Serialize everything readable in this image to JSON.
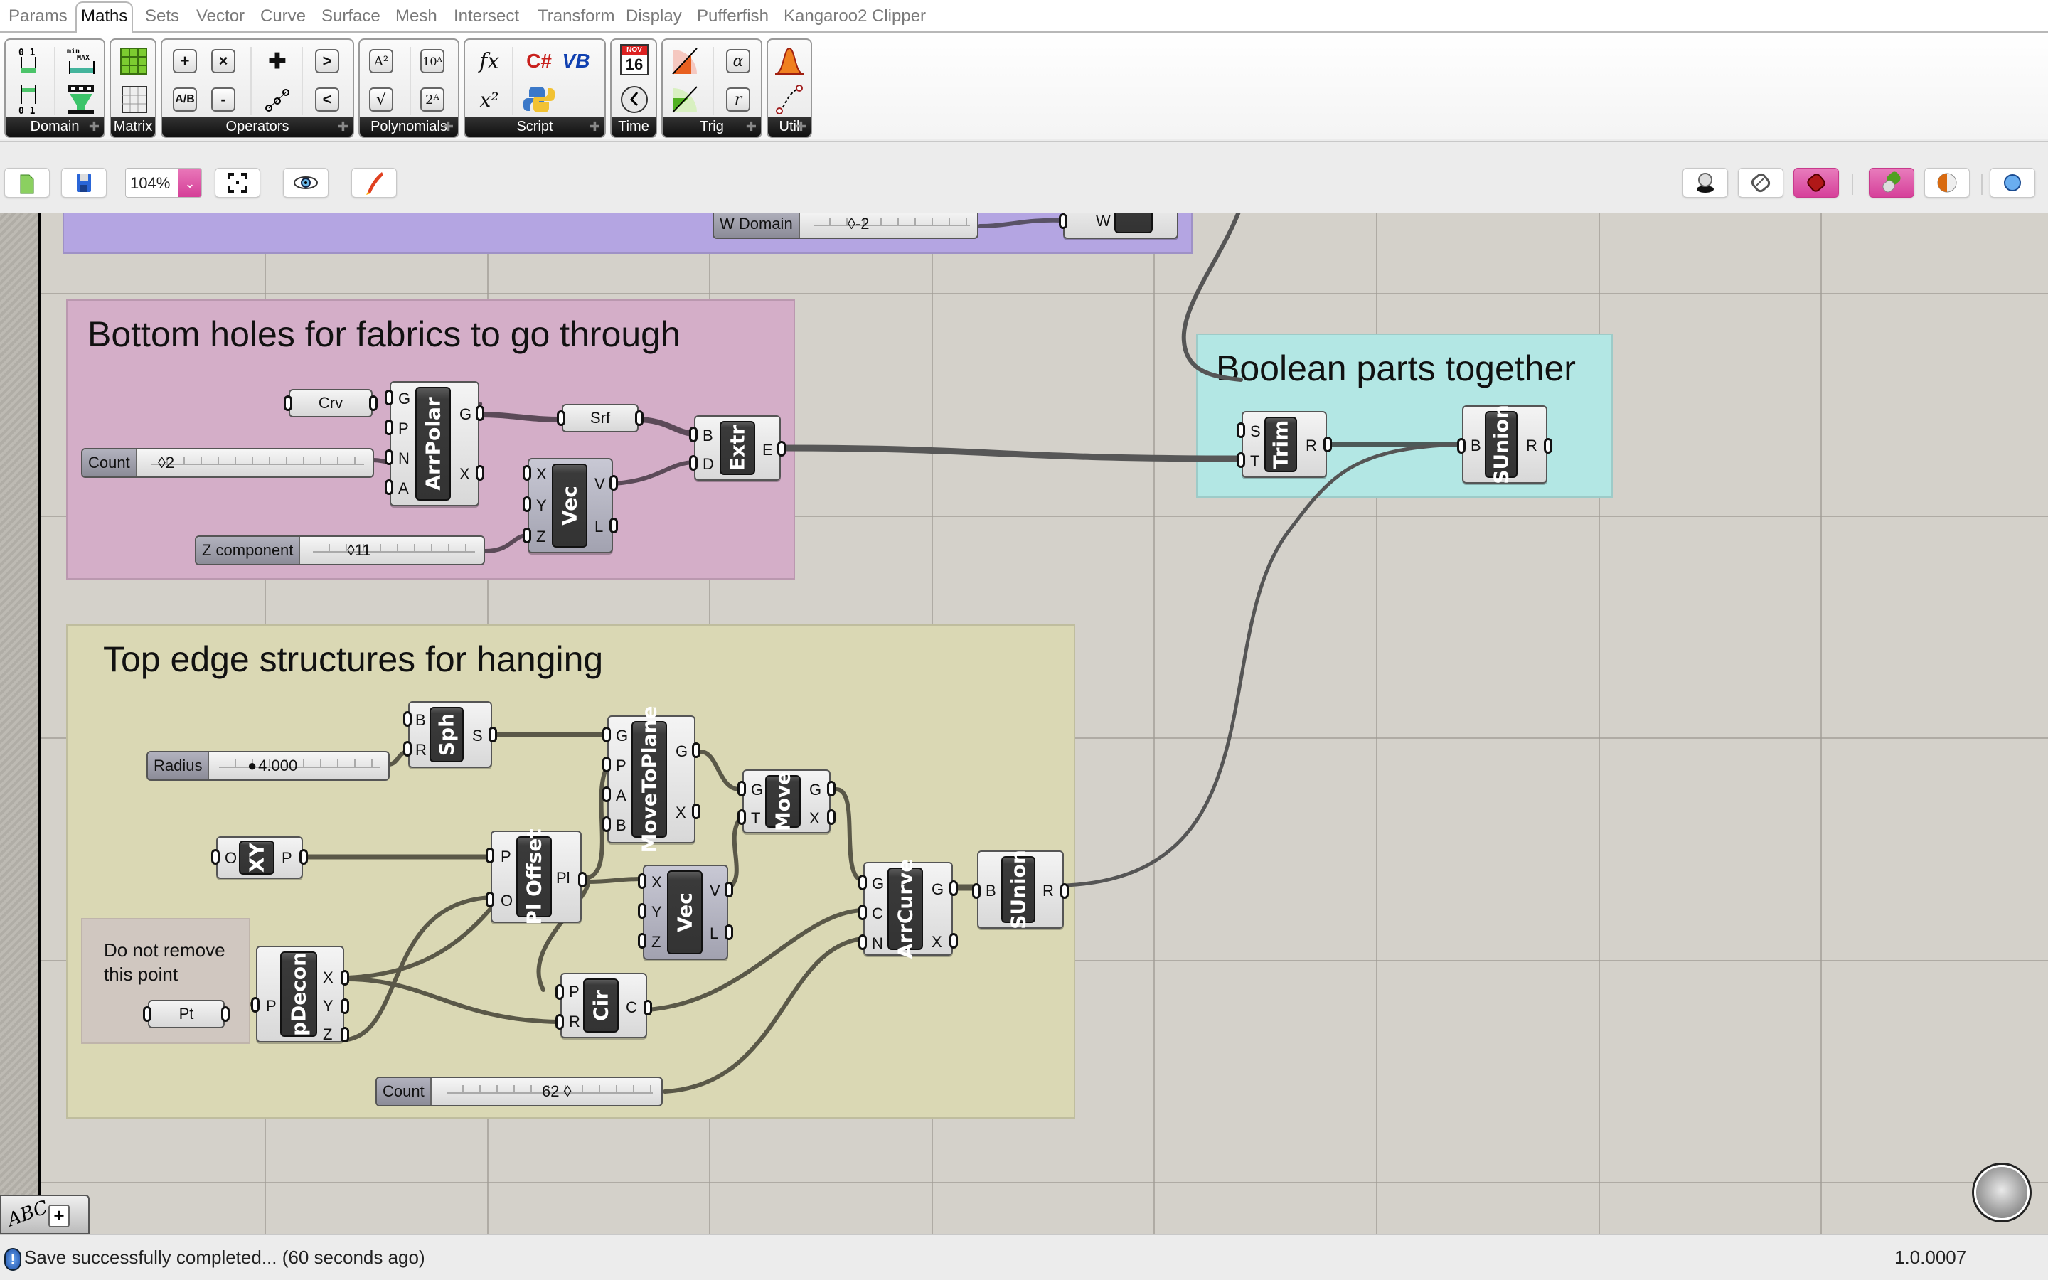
{
  "tabs": [
    "Params",
    "Maths",
    "Sets",
    "Vector",
    "Curve",
    "Surface",
    "Mesh",
    "Intersect",
    "Transform",
    "Display",
    "Pufferfish",
    "Kangaroo2",
    "Clipper"
  ],
  "active_tab": "Maths",
  "ribbon": {
    "panels": [
      {
        "label": "Domain",
        "icons": [
          "construct-domain-icon",
          "remap-domain-icon",
          "deconstruct-domain-icon",
          "bounds-icon"
        ]
      },
      {
        "label": "Matrix",
        "icons": [
          "matrix-icon",
          "deconstruct-matrix-icon"
        ]
      },
      {
        "label": "Operators",
        "icons": [
          "addition-icon",
          "multiplication-icon",
          "division-icon",
          "subtraction-icon",
          "mass-addition-icon",
          "series-icon",
          "larger-than-icon",
          "smaller-than-icon"
        ],
        "glyphs": {
          "add": "+",
          "mul": "×",
          "div": "A/B",
          "sub": "-",
          "gt": ">",
          "lt": "<"
        }
      },
      {
        "label": "Polynomials",
        "icons": [
          "square-icon",
          "power-of-10-icon",
          "square-root-icon",
          "power-of-2-icon"
        ],
        "glyphs": {
          "sq": "A²",
          "p10": "10ᴬ",
          "sqrt": "√",
          "p2": "2ᴬ"
        }
      },
      {
        "label": "Script",
        "icons": [
          "expression-icon",
          "csharp-icon",
          "vb-icon",
          "evaluate-icon",
          "python-icon"
        ],
        "glyphs": {
          "fx": "fx",
          "cs": "C#",
          "vb": "VB",
          "x2": "x²"
        }
      },
      {
        "label": "Time",
        "icons": [
          "calendar-icon",
          "clock-icon"
        ],
        "glyphs": {
          "month": "NOV",
          "day": "16"
        }
      },
      {
        "label": "Trig",
        "icons": [
          "sine-icon",
          "cosine-icon",
          "degrees-icon",
          "radians-icon"
        ],
        "glyphs": {
          "alpha": "α",
          "r": "r"
        }
      },
      {
        "label": "Util",
        "icons": [
          "gaussian-icon",
          "interpolate-icon"
        ]
      }
    ]
  },
  "toolbar": {
    "zoom": "104%",
    "buttons": [
      "open-file",
      "save-file",
      "zoom-extents",
      "preview-eye",
      "sketch"
    ],
    "right_buttons": [
      "preview-off",
      "preview-wireframe",
      "preview-shaded",
      "preview-selected",
      "preview-mesh-quality",
      "document-preview"
    ]
  },
  "groups": {
    "top": {
      "color": "#b4a5e2"
    },
    "bottom_holes": {
      "title": "Bottom holes for fabrics to go through",
      "color": "#d4aec8"
    },
    "boolean": {
      "title": "Boolean parts together",
      "color": "#b3e7e4"
    },
    "top_edge": {
      "title": "Top edge structures for hanging",
      "color": "#dad8b4"
    }
  },
  "components": {
    "w_domain": {
      "label": "W Domain",
      "value": "-2"
    },
    "w_param": {
      "port": "W"
    },
    "crv": {
      "label": "Crv"
    },
    "count1": {
      "label": "Count",
      "value": "2"
    },
    "arrpolar": {
      "name": "ArrPolar",
      "inputs": [
        "G",
        "P",
        "N",
        "A"
      ],
      "outputs": [
        "G",
        "X"
      ]
    },
    "srf": {
      "label": "Srf"
    },
    "zcomp": {
      "label": "Z component",
      "value": "11"
    },
    "vec1": {
      "name": "Vec",
      "inputs": [
        "X",
        "Y",
        "Z"
      ],
      "outputs": [
        "V",
        "L"
      ]
    },
    "extr": {
      "name": "Extr",
      "inputs": [
        "B",
        "D"
      ],
      "outputs": [
        "E"
      ]
    },
    "trim": {
      "name": "Trim",
      "inputs": [
        "S",
        "T"
      ],
      "outputs": [
        "R"
      ]
    },
    "sunion1": {
      "name": "SUnion",
      "inputs": [
        "B"
      ],
      "outputs": [
        "R"
      ]
    },
    "sph": {
      "name": "Sph",
      "inputs": [
        "B",
        "R"
      ],
      "outputs": [
        "S"
      ]
    },
    "radius": {
      "label": "Radius",
      "value": "4.000"
    },
    "movetoplane": {
      "name": "MoveToPlane",
      "inputs": [
        "G",
        "P",
        "A",
        "B"
      ],
      "outputs": [
        "G",
        "X"
      ]
    },
    "move": {
      "name": "Move",
      "inputs": [
        "G",
        "T"
      ],
      "outputs": [
        "G",
        "X"
      ]
    },
    "xy": {
      "name": "XY",
      "inputs": [
        "O"
      ],
      "outputs": [
        "P"
      ]
    },
    "ploffset": {
      "name": "Pl Offset",
      "inputs": [
        "P",
        "O"
      ],
      "outputs": [
        "Pl"
      ]
    },
    "vec2": {
      "name": "Vec",
      "inputs": [
        "X",
        "Y",
        "Z"
      ],
      "outputs": [
        "V",
        "L"
      ]
    },
    "arrcurve": {
      "name": "ArrCurve",
      "inputs": [
        "G",
        "C",
        "N"
      ],
      "outputs": [
        "G",
        "X"
      ]
    },
    "sunion2": {
      "name": "SUnion",
      "inputs": [
        "B"
      ],
      "outputs": [
        "R"
      ]
    },
    "note": {
      "text_line1": "Do not remove",
      "text_line2": "this point"
    },
    "pt": {
      "label": "Pt"
    },
    "pdecon": {
      "name": "pDecon",
      "inputs": [
        "P"
      ],
      "outputs": [
        "X",
        "Y",
        "Z"
      ]
    },
    "cir": {
      "name": "Cir",
      "inputs": [
        "P",
        "R"
      ],
      "outputs": [
        "C"
      ]
    },
    "count2": {
      "label": "Count",
      "value": "62"
    }
  },
  "bottom": {
    "abc": "ABC",
    "plus": "+"
  },
  "status": {
    "message": "Save successfully completed... (60 seconds ago)",
    "version": "1.0.0007"
  }
}
